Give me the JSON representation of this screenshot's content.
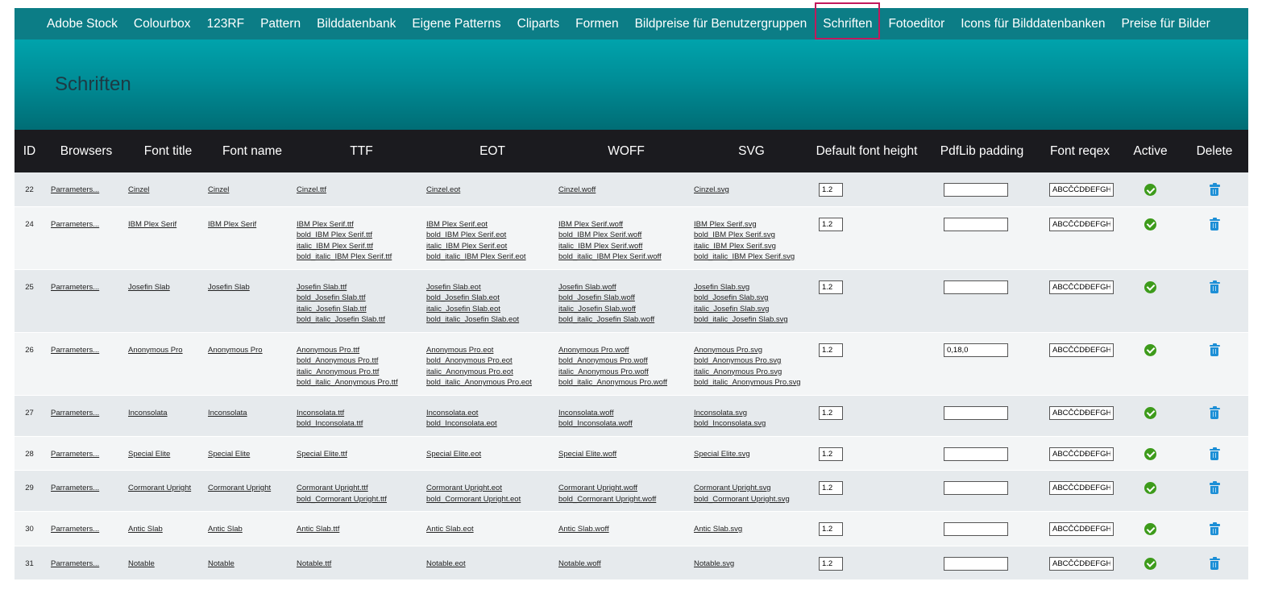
{
  "nav": {
    "items": [
      {
        "label": "Adobe Stock"
      },
      {
        "label": "Colourbox"
      },
      {
        "label": "123RF"
      },
      {
        "label": "Pattern"
      },
      {
        "label": "Bilddatenbank"
      },
      {
        "label": "Eigene Patterns"
      },
      {
        "label": "Cliparts"
      },
      {
        "label": "Formen"
      },
      {
        "label": "Bildpreise für Benutzergruppen"
      },
      {
        "label": "Schriften"
      },
      {
        "label": "Fotoeditor"
      },
      {
        "label": "Icons für Bilddatenbanken"
      },
      {
        "label": "Preise für Bilder"
      }
    ],
    "active_index": 9,
    "active_color": "#c2185b"
  },
  "page": {
    "title": "Schriften"
  },
  "table": {
    "headers": {
      "id": "ID",
      "browsers": "Browsers",
      "font_title": "Font title",
      "font_name": "Font name",
      "ttf": "TTF",
      "eot": "EOT",
      "woff": "WOFF",
      "svg": "SVG",
      "default_height": "Default font height",
      "pdflib": "PdfLib padding",
      "regex": "Font reqex",
      "active": "Active",
      "delete": "Delete"
    },
    "rows": [
      {
        "id": "22",
        "browsers": "Parrameters...",
        "font_title": "Cinzel",
        "font_name": "Cinzel",
        "ttf": [
          "Cinzel.ttf"
        ],
        "eot": [
          "Cinzel.eot"
        ],
        "woff": [
          "Cinzel.woff"
        ],
        "svg": [
          "Cinzel.svg"
        ],
        "height": "1.2",
        "pdflib": "",
        "regex": "ABCČĆDĐEFGHIJK"
      },
      {
        "id": "24",
        "browsers": "Parrameters...",
        "font_title": "IBM Plex Serif",
        "font_name": "IBM Plex Serif",
        "ttf": [
          "IBM Plex Serif.ttf",
          "bold_IBM Plex Serif.ttf",
          "italic_IBM Plex Serif.ttf",
          "bold_italic_IBM Plex Serif.ttf"
        ],
        "eot": [
          "IBM Plex Serif.eot",
          "bold_IBM Plex Serif.eot",
          "italic_IBM Plex Serif.eot",
          "bold_italic_IBM Plex Serif.eot"
        ],
        "woff": [
          "IBM Plex Serif.woff",
          "bold_IBM Plex Serif.woff",
          "italic_IBM Plex Serif.woff",
          "bold_italic_IBM Plex Serif.woff"
        ],
        "svg": [
          "IBM Plex Serif.svg",
          "bold_IBM Plex Serif.svg",
          "italic_IBM Plex Serif.svg",
          "bold_italic_IBM Plex Serif.svg"
        ],
        "height": "1.2",
        "pdflib": "",
        "regex": "ABCČĆDĐEFGHIJK"
      },
      {
        "id": "25",
        "browsers": "Parrameters...",
        "font_title": "Josefin Slab",
        "font_name": "Josefin Slab",
        "ttf": [
          "Josefin Slab.ttf",
          "bold_Josefin Slab.ttf",
          "italic_Josefin Slab.ttf",
          "bold_italic_Josefin Slab.ttf"
        ],
        "eot": [
          "Josefin Slab.eot",
          "bold_Josefin Slab.eot",
          "italic_Josefin Slab.eot",
          "bold_italic_Josefin Slab.eot"
        ],
        "woff": [
          "Josefin Slab.woff",
          "bold_Josefin Slab.woff",
          "italic_Josefin Slab.woff",
          "bold_italic_Josefin Slab.woff"
        ],
        "svg": [
          "Josefin Slab.svg",
          "bold_Josefin Slab.svg",
          "italic_Josefin Slab.svg",
          "bold_italic_Josefin Slab.svg"
        ],
        "height": "1.2",
        "pdflib": "",
        "regex": "ABCČĆDĐEFGHIJK"
      },
      {
        "id": "26",
        "browsers": "Parrameters...",
        "font_title": "Anonymous Pro",
        "font_name": "Anonymous Pro",
        "ttf": [
          "Anonymous Pro.ttf",
          "bold_Anonymous Pro.ttf",
          "italic_Anonymous Pro.ttf",
          "bold_italic_Anonymous Pro.ttf"
        ],
        "eot": [
          "Anonymous Pro.eot",
          "bold_Anonymous Pro.eot",
          "italic_Anonymous Pro.eot",
          "bold_italic_Anonymous Pro.eot"
        ],
        "woff": [
          "Anonymous Pro.woff",
          "bold_Anonymous Pro.woff",
          "italic_Anonymous Pro.woff",
          "bold_italic_Anonymous Pro.woff"
        ],
        "svg": [
          "Anonymous Pro.svg",
          "bold_Anonymous Pro.svg",
          "italic_Anonymous Pro.svg",
          "bold_italic_Anonymous Pro.svg"
        ],
        "height": "1.2",
        "pdflib": "0,18,0",
        "regex": "ABCČĆDĐEFGHIJK"
      },
      {
        "id": "27",
        "browsers": "Parrameters...",
        "font_title": "Inconsolata",
        "font_name": "Inconsolata",
        "ttf": [
          "Inconsolata.ttf",
          "bold_Inconsolata.ttf"
        ],
        "eot": [
          "Inconsolata.eot",
          "bold_Inconsolata.eot"
        ],
        "woff": [
          "Inconsolata.woff",
          "bold_Inconsolata.woff"
        ],
        "svg": [
          "Inconsolata.svg",
          "bold_Inconsolata.svg"
        ],
        "height": "1.2",
        "pdflib": "",
        "regex": "ABCČĆDĐEFGHIJK"
      },
      {
        "id": "28",
        "browsers": "Parrameters...",
        "font_title": "Special Elite",
        "font_name": "Special Elite",
        "ttf": [
          "Special Elite.ttf"
        ],
        "eot": [
          "Special Elite.eot"
        ],
        "woff": [
          "Special Elite.woff"
        ],
        "svg": [
          "Special Elite.svg"
        ],
        "height": "1.2",
        "pdflib": "",
        "regex": "ABCČĆDĐEFGHIJK"
      },
      {
        "id": "29",
        "browsers": "Parrameters...",
        "font_title": "Cormorant Upright",
        "font_name": "Cormorant Upright",
        "ttf": [
          "Cormorant Upright.ttf",
          "bold_Cormorant Upright.ttf"
        ],
        "eot": [
          "Cormorant Upright.eot",
          "bold_Cormorant Upright.eot"
        ],
        "woff": [
          "Cormorant Upright.woff",
          "bold_Cormorant Upright.woff"
        ],
        "svg": [
          "Cormorant Upright.svg",
          "bold_Cormorant Upright.svg"
        ],
        "height": "1.2",
        "pdflib": "",
        "regex": "ABCČĆDĐEFGHIJK"
      },
      {
        "id": "30",
        "browsers": "Parrameters...",
        "font_title": "Antic Slab",
        "font_name": "Antic Slab",
        "ttf": [
          "Antic Slab.ttf"
        ],
        "eot": [
          "Antic Slab.eot"
        ],
        "woff": [
          "Antic Slab.woff"
        ],
        "svg": [
          "Antic Slab.svg"
        ],
        "height": "1.2",
        "pdflib": "",
        "regex": "ABCČĆDĐEFGHIJK"
      },
      {
        "id": "31",
        "browsers": "Parrameters...",
        "font_title": "Notable",
        "font_name": "Notable",
        "ttf": [
          "Notable.ttf"
        ],
        "eot": [
          "Notable.eot"
        ],
        "woff": [
          "Notable.woff"
        ],
        "svg": [
          "Notable.svg"
        ],
        "height": "1.2",
        "pdflib": "",
        "regex": "ABCČĆDĐEFGHIJK"
      }
    ]
  },
  "icons": {
    "active": "check-circle-icon",
    "delete": "trash-icon"
  },
  "colors": {
    "nav_bg": "#0c7d86",
    "header_bg": "#1b1b1f",
    "active_green": "#3d9b1b",
    "delete_blue": "#1d8fd6"
  }
}
